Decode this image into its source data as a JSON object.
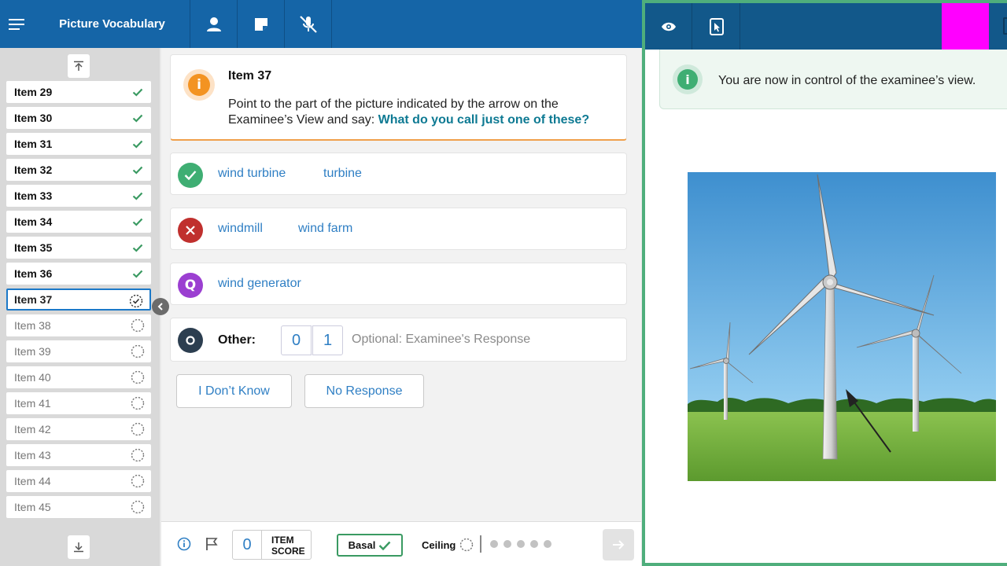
{
  "app": {
    "title": "Picture Vocabulary"
  },
  "sidebar": {
    "items": [
      {
        "label": "Item 29",
        "status": "done"
      },
      {
        "label": "Item 30",
        "status": "done"
      },
      {
        "label": "Item 31",
        "status": "done"
      },
      {
        "label": "Item 32",
        "status": "done"
      },
      {
        "label": "Item 33",
        "status": "done"
      },
      {
        "label": "Item 34",
        "status": "done"
      },
      {
        "label": "Item 35",
        "status": "done"
      },
      {
        "label": "Item 36",
        "status": "done"
      },
      {
        "label": "Item 37",
        "status": "current"
      },
      {
        "label": "Item 38",
        "status": "pending"
      },
      {
        "label": "Item 39",
        "status": "pending"
      },
      {
        "label": "Item 40",
        "status": "pending"
      },
      {
        "label": "Item 41",
        "status": "pending"
      },
      {
        "label": "Item 42",
        "status": "pending"
      },
      {
        "label": "Item 43",
        "status": "pending"
      },
      {
        "label": "Item 44",
        "status": "pending"
      },
      {
        "label": "Item 45",
        "status": "pending"
      }
    ]
  },
  "item": {
    "title": "Item 37",
    "instruction": "Point to the part of the picture indicated by the arrow on the Examinee’s View and say: ",
    "prompt": "What do you call just one of these?"
  },
  "responses": {
    "correct": [
      "wind turbine",
      "turbine"
    ],
    "incorrect": [
      "windmill",
      "wind farm"
    ],
    "query": [
      "wind generator"
    ],
    "other": {
      "label": "Other:",
      "scores": [
        "0",
        "1"
      ],
      "placeholder": "Optional: Examinee's Response"
    }
  },
  "actions": {
    "dont_know": "I Don’t Know",
    "no_response": "No Response"
  },
  "bottom": {
    "item_score": "0",
    "item_score_label_1": "ITEM",
    "item_score_label_2": "SCORE",
    "basal_label": "Basal",
    "ceiling_label": "Ceiling",
    "ceiling_dots": 5
  },
  "examinee": {
    "notice": "You are now in control of the examinee’s view."
  },
  "colors": {
    "header": "#1565a7",
    "right_header": "#12588a",
    "accent_green": "#3fae73",
    "correct": "#3fae73",
    "incorrect": "#c0302e",
    "query": "#9b3fd1",
    "other": "#2c3e50",
    "marker": "#ff00ff"
  }
}
